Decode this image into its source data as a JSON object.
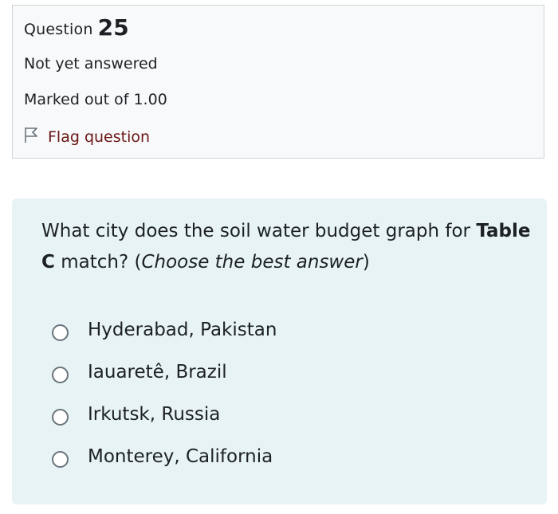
{
  "question_info": {
    "title_prefix": "Question",
    "number": "25",
    "state": "Not yet answered",
    "grade": "Marked out of 1.00",
    "flag_label": "Flag question"
  },
  "formulation": {
    "text_part1": "What city does the soil water budget graph for ",
    "text_bold": "Table C",
    "text_part2": " match? (",
    "text_italic": "Choose the best answer",
    "text_part3": ")",
    "options": [
      {
        "label": "Hyderabad, Pakistan",
        "selected": false
      },
      {
        "label": "Iauaretê, Brazil",
        "selected": false
      },
      {
        "label": "Irkutsk, Russia",
        "selected": false
      },
      {
        "label": "Monterey, California",
        "selected": false
      }
    ]
  },
  "icons": {
    "flag": "flag-outline-icon",
    "radio": "radio-unchecked-icon"
  },
  "colors": {
    "info_bg": "#f8f9fa",
    "info_border": "#cfd4d9",
    "formulation_bg": "#e7f3f5",
    "flag_link": "#6b1515",
    "text": "#1d2125"
  }
}
